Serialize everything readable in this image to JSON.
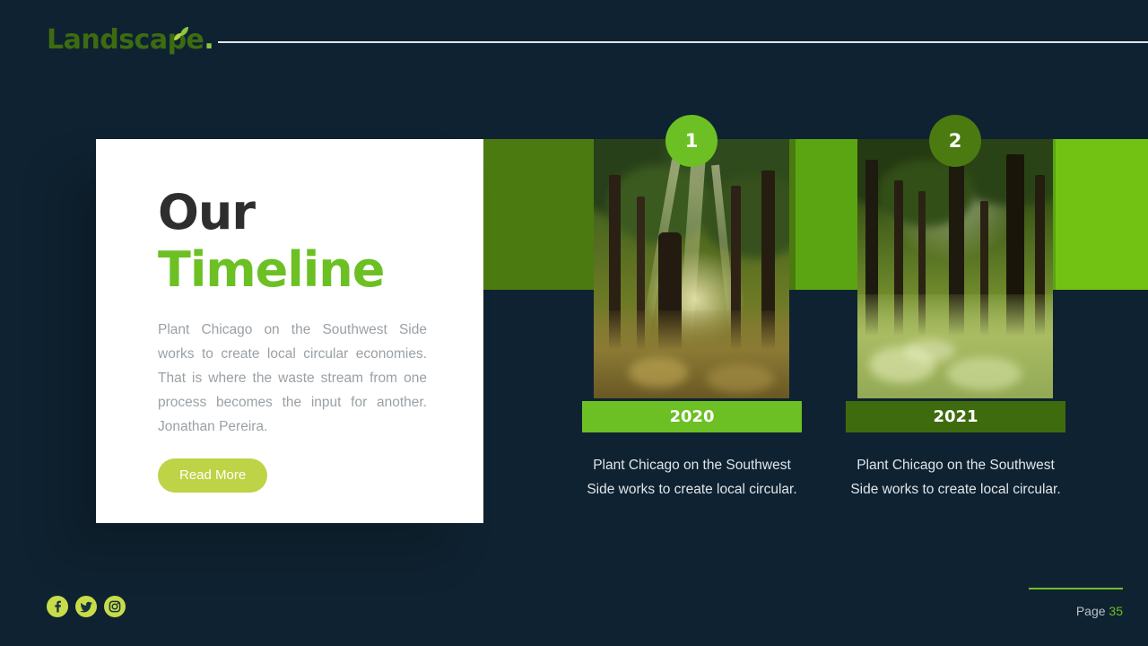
{
  "brand": {
    "name": "Landscape",
    "dot": ".",
    "leaf_icon": "leaf-icon"
  },
  "card": {
    "title_line1": "Our",
    "title_line2": "Timeline",
    "body": "Plant Chicago on the Southwest Side works to create local circular economies. That is where the waste stream from one process becomes the input for another. Jonathan Pereira.",
    "read_more_label": "Read More"
  },
  "timeline": {
    "items": [
      {
        "badge": "1",
        "year": "2020",
        "caption": "Plant Chicago on the Southwest Side works to create local circular.",
        "badge_color": "#6cc024",
        "year_bar_color": "#6cc024"
      },
      {
        "badge": "2",
        "year": "2021",
        "caption": "Plant Chicago on the Southwest Side works to create local circular.",
        "badge_color": "#4b7a10",
        "year_bar_color": "#3f6b0f"
      }
    ]
  },
  "footer": {
    "social": [
      {
        "name": "facebook-icon"
      },
      {
        "name": "twitter-icon"
      },
      {
        "name": "instagram-icon"
      }
    ],
    "page_label": "Page",
    "page_number": "35"
  },
  "theme": {
    "background": "#0f2231",
    "accent_green": "#6cc024",
    "band_dark": "#4b7a10",
    "band_mid": "#5ca512",
    "band_bright": "#72c213",
    "button_green": "#bed346",
    "social_green": "#c8dc4a"
  }
}
